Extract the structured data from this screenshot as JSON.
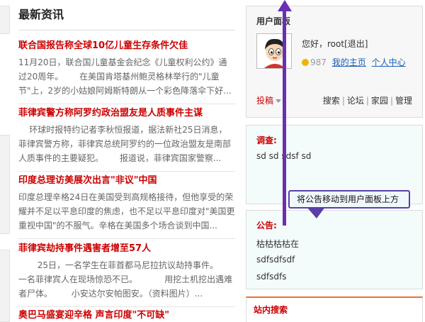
{
  "news": {
    "heading": "最新资讯",
    "items": [
      {
        "title": "联合国报告称全球10亿儿童生存条件欠佳",
        "summary": "11月20日，联合国儿童基金会纪念《儿童权利公约》通过20周年。      在美国肯塔基州鲍灵格林举行的\"儿童节\"上，2岁的小姑娘阿姆斯特朗从一个彩色降落伞下好..."
      },
      {
        "title": "菲律宾警方称阿罗约政治盟友是人质事件主谋",
        "summary": "    环球时报特约记者李秋恒报道，据法新社25日消息，菲律宾警方称，菲律宾总统阿罗约的一位政治盟友是南部人质事件的主要疑犯。      报道说，菲律宾国家警察..."
      },
      {
        "title": "印度总理访美展次出言\"非议\"中国",
        "summary": "印度总理辛格24日在美国受到高规格接待，但他享受的荣耀并不足以平息印度的焦虑，也不足以平息印度对\"美国更重视中国\"的不服气。辛格在美国多个场合谈到中国..."
      },
      {
        "title": "菲律宾劫持事件遇害者增至57人",
        "summary": "       25日，一名学生在菲首都马尼拉抗议劫持事件。    一名菲律宾人在现场惊恐不已。          用挖土机挖出遇难者尸体。       小安达尔安帕图安。（资料图片）..."
      },
      {
        "title": "奥巴马盛宴迎辛格 声言印度\"不可缺\"",
        "summary": ""
      }
    ]
  },
  "user_panel": {
    "title": "用户面板",
    "greeting": "您好，root",
    "logout": "[退出]",
    "credits": "987",
    "my_home": "我的主页",
    "personal_center": "个人中心",
    "post": "投稿",
    "links": [
      "搜索",
      "论坛",
      "家园",
      "管理"
    ]
  },
  "survey": {
    "label": "调查:",
    "text": "sd sd sdsf sd"
  },
  "notice": {
    "label": "公告:",
    "lines": [
      "枯枯枯枯在",
      "sdfsdfsdf",
      "sdfsdfs"
    ]
  },
  "site_search": {
    "label": "站内搜索"
  },
  "annotation": {
    "callout": "将公告移动到用户面板上方",
    "arrow_color": "#6a2fb3"
  },
  "colors": {
    "title_red": "#cc0000",
    "link_blue": "#1a5fb4",
    "accent_orange": "#e8732c"
  }
}
